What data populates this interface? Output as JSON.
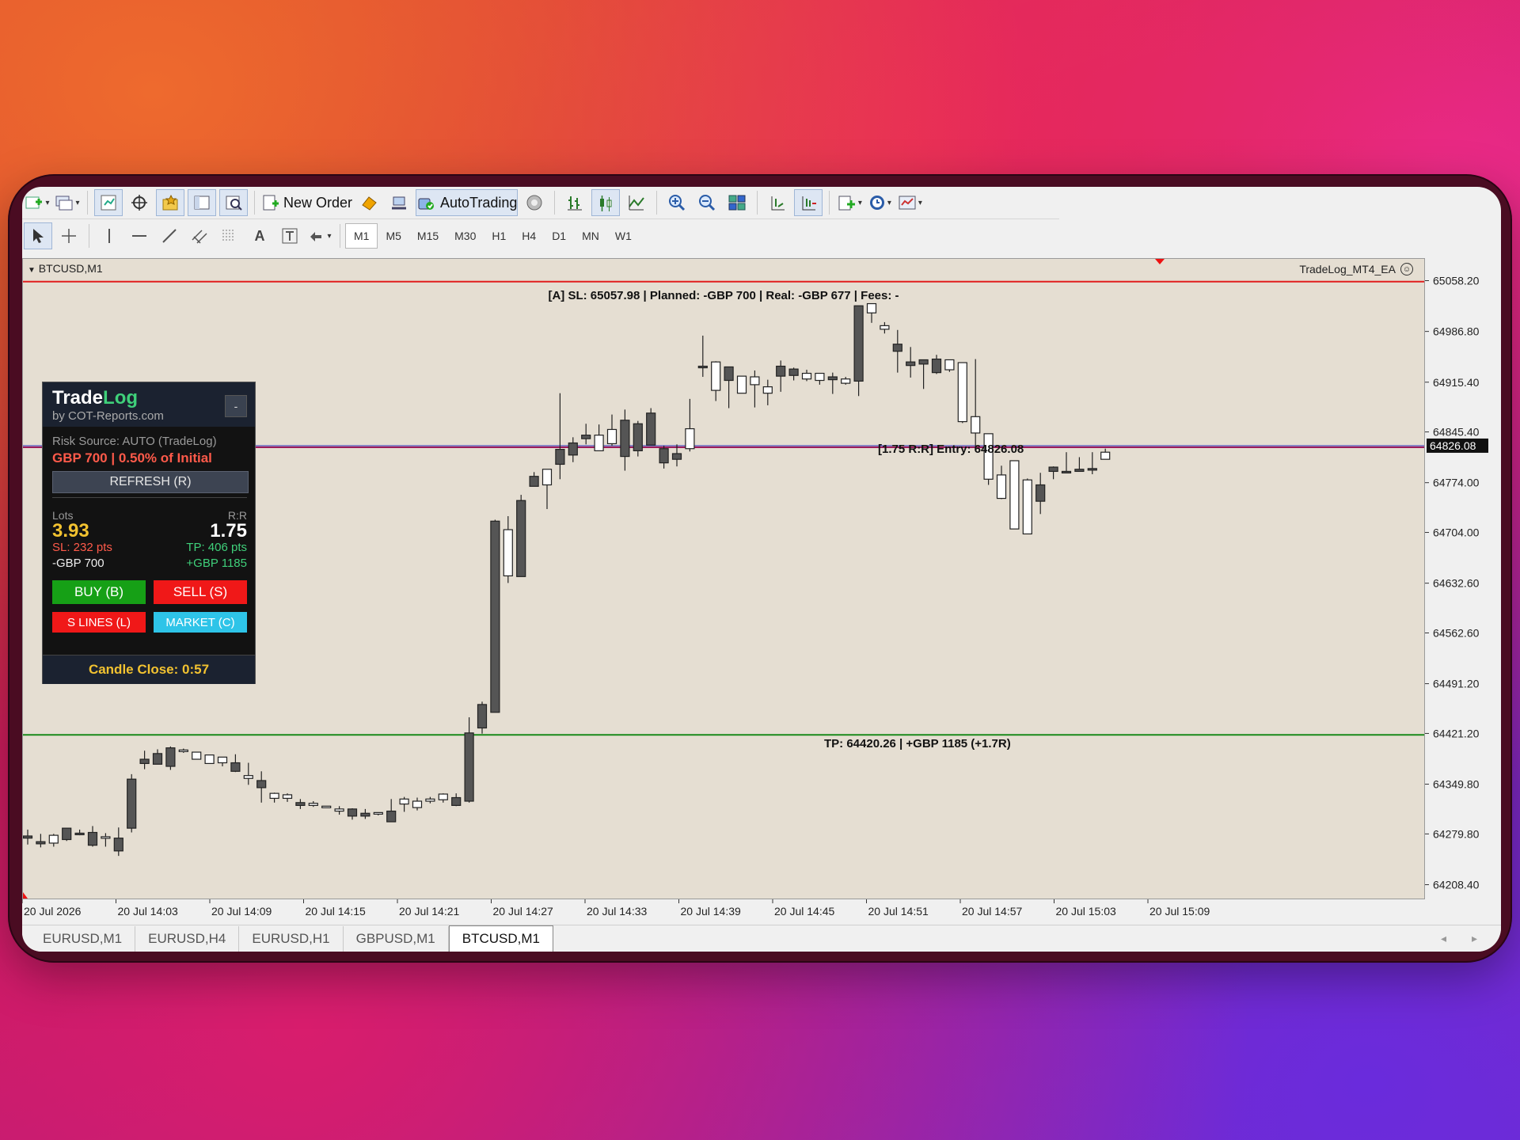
{
  "toolbar1": {
    "new_order_label": "New Order",
    "autotrading_label": "AutoTrading"
  },
  "toolbar2": {
    "timeframes": [
      "M1",
      "M5",
      "M15",
      "M30",
      "H1",
      "H4",
      "D1",
      "MN",
      "W1"
    ],
    "selected_timeframe": "M1",
    "text_tool": "A"
  },
  "chart": {
    "symbol_label": "BTCUSD,M1",
    "ea_label": "TradeLog_MT4_EA",
    "sl_line_label": "[A] SL: 65057.98 | Planned: -GBP 700 | Real: -GBP 677 | Fees: -",
    "entry_line_label": "[1.75 R:R] Entry: 64826.08",
    "tp_line_label": "TP: 64420.26 | +GBP 1185 (+1.7R)",
    "current_price": "64826.08",
    "price_labels": [
      "65058.20",
      "64986.80",
      "64915.40",
      "64845.40",
      "64774.00",
      "64704.00",
      "64632.60",
      "64562.60",
      "64491.20",
      "64421.20",
      "64349.80",
      "64279.80",
      "64208.40"
    ],
    "time_labels": [
      "20 Jul 2026",
      "20 Jul 14:03",
      "20 Jul 14:09",
      "20 Jul 14:15",
      "20 Jul 14:21",
      "20 Jul 14:27",
      "20 Jul 14:33",
      "20 Jul 14:39",
      "20 Jul 14:45",
      "20 Jul 14:51",
      "20 Jul 14:57",
      "20 Jul 15:03",
      "20 Jul 15:09"
    ],
    "colors": {
      "sl": "#e11d1d",
      "entry": "#9b1b5a",
      "bid": "#2a2ab8",
      "tp": "#1a8a1a",
      "bull_body": "#ffffff",
      "bear_body": "#555555",
      "wick": "#222222"
    }
  },
  "panel": {
    "title_trade": "Trade",
    "title_log": "Log",
    "subtitle": "by COT-Reports.com",
    "minimize_label": "-",
    "risk_source": "Risk Source: AUTO (TradeLog)",
    "risk_amount": "GBP 700 | 0.50% of Initial",
    "refresh_label": "REFRESH (R)",
    "lots_label": "Lots",
    "lots_value": "3.93",
    "rr_label": "R:R",
    "rr_value": "1.75",
    "sl_pts": "SL: 232 pts",
    "tp_pts": "TP: 406 pts",
    "sl_money": "-GBP 700",
    "tp_money": "+GBP 1185",
    "buy_label": "BUY (B)",
    "sell_label": "SELL (S)",
    "slines_label": "S LINES (L)",
    "market_label": "MARKET (C)",
    "candle_close": "Candle Close: 0:57"
  },
  "tabs": {
    "items": [
      "EURUSD,M1",
      "EURUSD,H4",
      "EURUSD,H1",
      "GBPUSD,M1",
      "BTCUSD,M1"
    ],
    "active": "BTCUSD,M1"
  }
}
